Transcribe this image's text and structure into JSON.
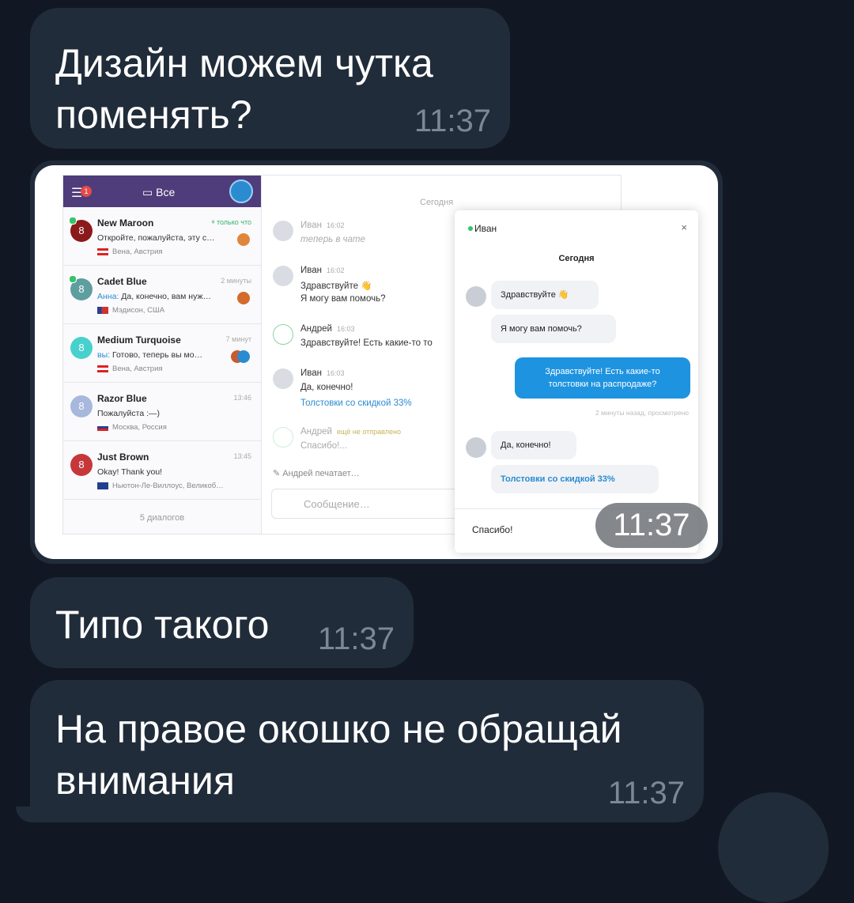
{
  "messages": [
    {
      "text": "Дизайн можем чутка\nпоменять?",
      "time": "11:37"
    },
    {
      "text": "Типо такого",
      "time": "11:37"
    },
    {
      "text": "На правое окошко не обращай\nвнимания",
      "time": "11:37"
    }
  ],
  "photo": {
    "time": "11:37",
    "sidebar": {
      "badge": "1",
      "title": "Все",
      "footer": "5 диалогов",
      "dialogs": [
        {
          "initial": "8",
          "name": "New Maroon",
          "time": "только что",
          "last_prefix": "",
          "last": "Откройте, пожалуйста, эту с…",
          "location": "Вена, Австрия",
          "color": "#8b1a1a"
        },
        {
          "initial": "8",
          "name": "Cadet Blue",
          "time": "2 минуты",
          "last_prefix": "Анна:",
          "last": " Да, конечно, вам нуж…",
          "location": "Мэдисон, США",
          "color": "#5f9ea0"
        },
        {
          "initial": "8",
          "name": "Medium Turquoise",
          "time": "7 минут",
          "last_prefix": "вы:",
          "last": " Готово, теперь вы мо…",
          "location": "Вена, Австрия",
          "color": "#48d1cc"
        },
        {
          "initial": "8",
          "name": "Razor Blue",
          "time": "13:46",
          "last_prefix": "",
          "last": "Пожалуйста :—)",
          "location": "Москва, Россия",
          "color": "#a7b8dc"
        },
        {
          "initial": "8",
          "name": "Just Brown",
          "time": "13:45",
          "last_prefix": "",
          "last": "Okay! Thank you!",
          "location": "Ньютон-Ле-Виллоус, Великоб…",
          "color": "#c7373a"
        }
      ]
    },
    "chat": {
      "day": "Сегодня",
      "messages": [
        {
          "author": "Иван",
          "time": "16:02",
          "lines": [
            "теперь в чате"
          ]
        },
        {
          "author": "Иван",
          "time": "16:02",
          "lines": [
            "Здравствуйте 👋",
            "Я могу вам помочь?"
          ]
        },
        {
          "author": "Андрей",
          "time": "16:03",
          "lines": [
            "Здравствуйте! Есть какие-то то"
          ]
        },
        {
          "author": "Иван",
          "time": "16:03",
          "lines": [
            "Да, конечно!",
            "Толстовки со скидкой 33%"
          ]
        },
        {
          "author": "Андрей",
          "time": "ещё не отправлено",
          "lines": [
            "Спасибо!..."
          ]
        }
      ],
      "typing": "✎ Андрей печатает…",
      "input_placeholder": "Сообщение…"
    },
    "widget": {
      "name": "Иван",
      "close": "×",
      "day": "Сегодня",
      "bubble1": "Здравствуйте 👋",
      "bubble2": "Я могу вам помочь?",
      "bubble3": "Здравствуйте! Есть какие-то толстовки на распродаже?",
      "seen": "2 минуты назад, просмотрено",
      "bubble4": "Да, конечно!",
      "bubble5": "Толстовки со скидкой 33%",
      "input": "Спасибо!"
    }
  }
}
